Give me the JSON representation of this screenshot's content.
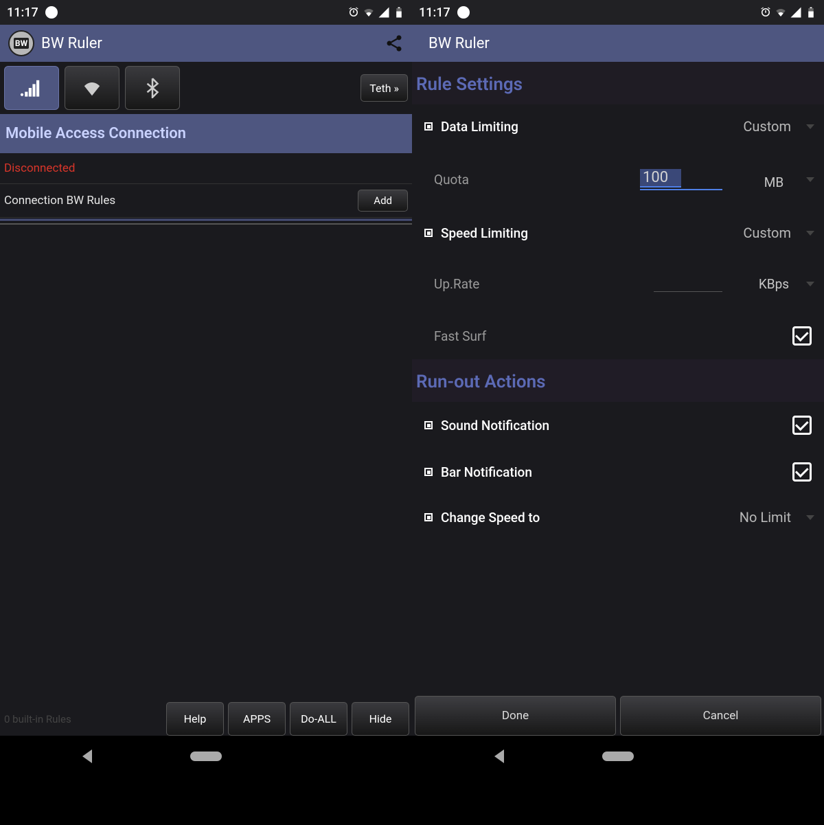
{
  "status": {
    "time": "11:17"
  },
  "app": {
    "title": "BW Ruler",
    "logo_text": "BW"
  },
  "left": {
    "teth_button": "Teth »",
    "section_header": "Mobile Access Connection",
    "status_text": "Disconnected",
    "rules_label": "Connection BW Rules",
    "add_button": "Add",
    "faded_footer": "0 built-in Rules",
    "buttons": {
      "help": "Help",
      "apps": "APPS",
      "doall": "Do-ALL",
      "hide": "Hide"
    }
  },
  "right": {
    "title": "Rule Settings",
    "data_limiting": {
      "label": "Data Limiting",
      "value": "Custom"
    },
    "quota": {
      "label": "Quota",
      "value": "100",
      "unit": "MB"
    },
    "speed_limiting": {
      "label": "Speed Limiting",
      "value": "Custom"
    },
    "up_rate": {
      "label": "Up.Rate",
      "unit": "KBps"
    },
    "fast_surf": {
      "label": "Fast Surf",
      "checked": true
    },
    "runout_title": "Run-out Actions",
    "sound_notif": {
      "label": "Sound Notification",
      "checked": true
    },
    "bar_notif": {
      "label": "Bar Notification",
      "checked": true
    },
    "change_speed": {
      "label": "Change Speed to",
      "value": "No Limit"
    },
    "buttons": {
      "done": "Done",
      "cancel": "Cancel"
    }
  }
}
